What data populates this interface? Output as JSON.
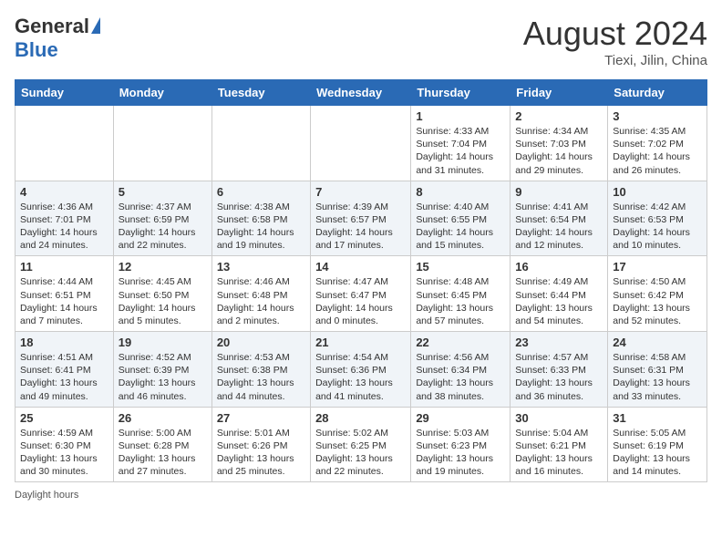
{
  "header": {
    "logo_general": "General",
    "logo_blue": "Blue",
    "month_year": "August 2024",
    "location": "Tiexi, Jilin, China"
  },
  "weekdays": [
    "Sunday",
    "Monday",
    "Tuesday",
    "Wednesday",
    "Thursday",
    "Friday",
    "Saturday"
  ],
  "weeks": [
    [
      {
        "day": "",
        "info": ""
      },
      {
        "day": "",
        "info": ""
      },
      {
        "day": "",
        "info": ""
      },
      {
        "day": "",
        "info": ""
      },
      {
        "day": "1",
        "info": "Sunrise: 4:33 AM\nSunset: 7:04 PM\nDaylight: 14 hours\nand 31 minutes."
      },
      {
        "day": "2",
        "info": "Sunrise: 4:34 AM\nSunset: 7:03 PM\nDaylight: 14 hours\nand 29 minutes."
      },
      {
        "day": "3",
        "info": "Sunrise: 4:35 AM\nSunset: 7:02 PM\nDaylight: 14 hours\nand 26 minutes."
      }
    ],
    [
      {
        "day": "4",
        "info": "Sunrise: 4:36 AM\nSunset: 7:01 PM\nDaylight: 14 hours\nand 24 minutes."
      },
      {
        "day": "5",
        "info": "Sunrise: 4:37 AM\nSunset: 6:59 PM\nDaylight: 14 hours\nand 22 minutes."
      },
      {
        "day": "6",
        "info": "Sunrise: 4:38 AM\nSunset: 6:58 PM\nDaylight: 14 hours\nand 19 minutes."
      },
      {
        "day": "7",
        "info": "Sunrise: 4:39 AM\nSunset: 6:57 PM\nDaylight: 14 hours\nand 17 minutes."
      },
      {
        "day": "8",
        "info": "Sunrise: 4:40 AM\nSunset: 6:55 PM\nDaylight: 14 hours\nand 15 minutes."
      },
      {
        "day": "9",
        "info": "Sunrise: 4:41 AM\nSunset: 6:54 PM\nDaylight: 14 hours\nand 12 minutes."
      },
      {
        "day": "10",
        "info": "Sunrise: 4:42 AM\nSunset: 6:53 PM\nDaylight: 14 hours\nand 10 minutes."
      }
    ],
    [
      {
        "day": "11",
        "info": "Sunrise: 4:44 AM\nSunset: 6:51 PM\nDaylight: 14 hours\nand 7 minutes."
      },
      {
        "day": "12",
        "info": "Sunrise: 4:45 AM\nSunset: 6:50 PM\nDaylight: 14 hours\nand 5 minutes."
      },
      {
        "day": "13",
        "info": "Sunrise: 4:46 AM\nSunset: 6:48 PM\nDaylight: 14 hours\nand 2 minutes."
      },
      {
        "day": "14",
        "info": "Sunrise: 4:47 AM\nSunset: 6:47 PM\nDaylight: 14 hours\nand 0 minutes."
      },
      {
        "day": "15",
        "info": "Sunrise: 4:48 AM\nSunset: 6:45 PM\nDaylight: 13 hours\nand 57 minutes."
      },
      {
        "day": "16",
        "info": "Sunrise: 4:49 AM\nSunset: 6:44 PM\nDaylight: 13 hours\nand 54 minutes."
      },
      {
        "day": "17",
        "info": "Sunrise: 4:50 AM\nSunset: 6:42 PM\nDaylight: 13 hours\nand 52 minutes."
      }
    ],
    [
      {
        "day": "18",
        "info": "Sunrise: 4:51 AM\nSunset: 6:41 PM\nDaylight: 13 hours\nand 49 minutes."
      },
      {
        "day": "19",
        "info": "Sunrise: 4:52 AM\nSunset: 6:39 PM\nDaylight: 13 hours\nand 46 minutes."
      },
      {
        "day": "20",
        "info": "Sunrise: 4:53 AM\nSunset: 6:38 PM\nDaylight: 13 hours\nand 44 minutes."
      },
      {
        "day": "21",
        "info": "Sunrise: 4:54 AM\nSunset: 6:36 PM\nDaylight: 13 hours\nand 41 minutes."
      },
      {
        "day": "22",
        "info": "Sunrise: 4:56 AM\nSunset: 6:34 PM\nDaylight: 13 hours\nand 38 minutes."
      },
      {
        "day": "23",
        "info": "Sunrise: 4:57 AM\nSunset: 6:33 PM\nDaylight: 13 hours\nand 36 minutes."
      },
      {
        "day": "24",
        "info": "Sunrise: 4:58 AM\nSunset: 6:31 PM\nDaylight: 13 hours\nand 33 minutes."
      }
    ],
    [
      {
        "day": "25",
        "info": "Sunrise: 4:59 AM\nSunset: 6:30 PM\nDaylight: 13 hours\nand 30 minutes."
      },
      {
        "day": "26",
        "info": "Sunrise: 5:00 AM\nSunset: 6:28 PM\nDaylight: 13 hours\nand 27 minutes."
      },
      {
        "day": "27",
        "info": "Sunrise: 5:01 AM\nSunset: 6:26 PM\nDaylight: 13 hours\nand 25 minutes."
      },
      {
        "day": "28",
        "info": "Sunrise: 5:02 AM\nSunset: 6:25 PM\nDaylight: 13 hours\nand 22 minutes."
      },
      {
        "day": "29",
        "info": "Sunrise: 5:03 AM\nSunset: 6:23 PM\nDaylight: 13 hours\nand 19 minutes."
      },
      {
        "day": "30",
        "info": "Sunrise: 5:04 AM\nSunset: 6:21 PM\nDaylight: 13 hours\nand 16 minutes."
      },
      {
        "day": "31",
        "info": "Sunrise: 5:05 AM\nSunset: 6:19 PM\nDaylight: 13 hours\nand 14 minutes."
      }
    ]
  ],
  "footer": {
    "label": "Daylight hours"
  }
}
